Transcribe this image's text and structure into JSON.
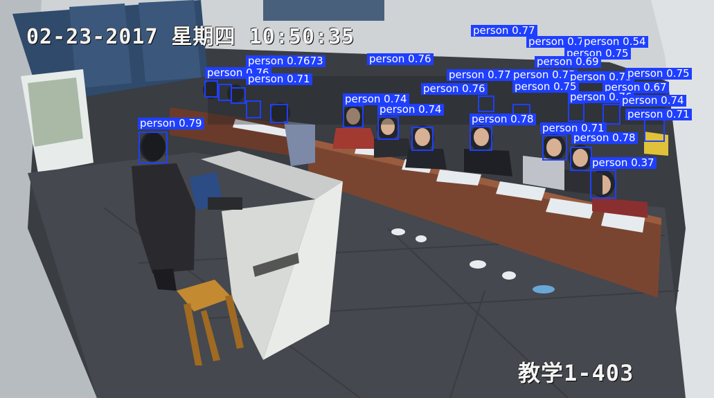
{
  "osd": {
    "timestamp": "02-23-2017 星期四 10:50:35",
    "room": "教学1-403"
  },
  "colors": {
    "box": "#1f3fff",
    "label_text": "#ffffff"
  },
  "detections": [
    {
      "label": "person 0.79"
    },
    {
      "label": "person 0.76"
    },
    {
      "label": "person 0.71"
    },
    {
      "label": "person 0.7673"
    },
    {
      "label": "person 0.74"
    },
    {
      "label": "person 0.74"
    },
    {
      "label": "person 0.76"
    },
    {
      "label": "person 0.77"
    },
    {
      "label": "person 0.78"
    },
    {
      "label": "person 0.76"
    },
    {
      "label": "person 0.75"
    },
    {
      "label": "person 0.77"
    },
    {
      "label": "person 0.76"
    },
    {
      "label": "person 0.54"
    },
    {
      "label": "person 0.75"
    },
    {
      "label": "person 0.73"
    },
    {
      "label": "person 0.75"
    },
    {
      "label": "person 0.67"
    },
    {
      "label": "person 0.76"
    },
    {
      "label": "person 0.74"
    },
    {
      "label": "person 0.71"
    },
    {
      "label": "person 0.71"
    },
    {
      "label": "person 0.78"
    },
    {
      "label": "person 0.37"
    },
    {
      "label": "person 0.75"
    },
    {
      "label": "person 0.69"
    }
  ]
}
